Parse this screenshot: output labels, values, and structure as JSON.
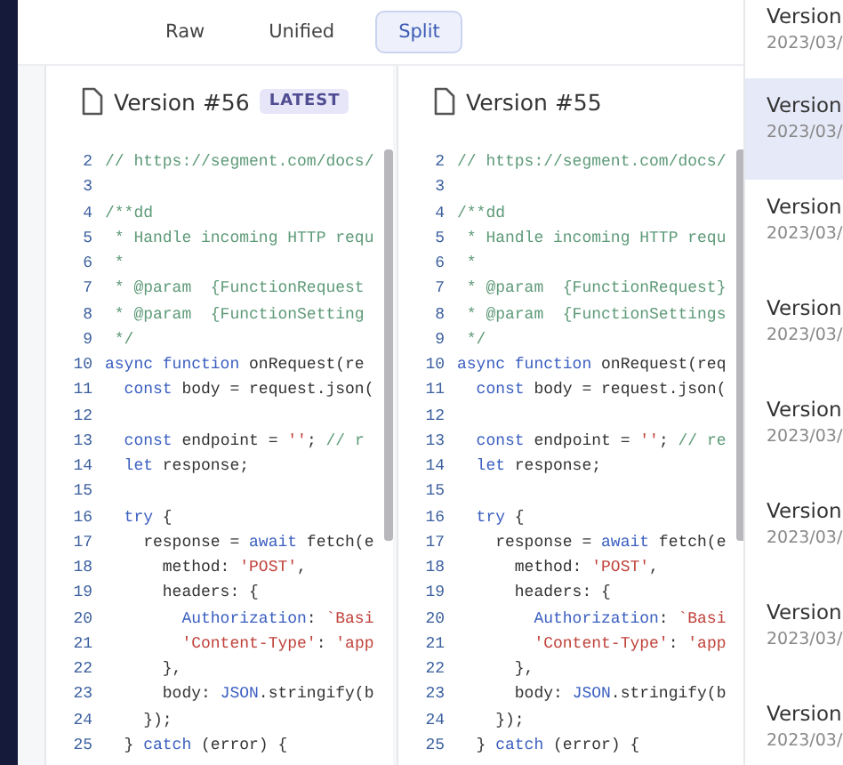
{
  "view_tabs": [
    {
      "label": "Raw",
      "selected": false
    },
    {
      "label": "Unified",
      "selected": false
    },
    {
      "label": "Split",
      "selected": true
    }
  ],
  "panels": [
    {
      "title": "Version #56",
      "badge": "LATEST",
      "lines": [
        {
          "number": "2",
          "tokens": [
            {
              "kind": "comment",
              "text": "// https://segment.com/docs/"
            }
          ]
        },
        {
          "number": "3"
        },
        {
          "number": "4",
          "tokens": [
            {
              "kind": "comment",
              "text": "/**dd"
            }
          ]
        },
        {
          "number": "5",
          "tokens": [
            {
              "kind": "comment",
              "text": " * Handle incoming HTTP requ"
            }
          ]
        },
        {
          "number": "6",
          "tokens": [
            {
              "kind": "comment",
              "text": " *"
            }
          ]
        },
        {
          "number": "7",
          "tokens": [
            {
              "kind": "comment",
              "text": " * @param  {FunctionRequest"
            }
          ]
        },
        {
          "number": "8",
          "tokens": [
            {
              "kind": "comment",
              "text": " * @param  {FunctionSetting"
            }
          ]
        },
        {
          "number": "9",
          "tokens": [
            {
              "kind": "comment",
              "text": " */"
            }
          ]
        },
        {
          "number": "10",
          "tokens": [
            {
              "kind": "keyword",
              "text": "async function "
            },
            {
              "kind": "plain",
              "text": "onRequest(re"
            }
          ]
        },
        {
          "number": "11",
          "tokens": [
            {
              "kind": "keyword",
              "text": "  const "
            },
            {
              "kind": "plain",
              "text": "body = request.json("
            }
          ]
        },
        {
          "number": "12"
        },
        {
          "number": "13",
          "tokens": [
            {
              "kind": "keyword",
              "text": "  const "
            },
            {
              "kind": "plain",
              "text": "endpoint = "
            },
            {
              "kind": "string",
              "text": "''"
            },
            {
              "kind": "plain",
              "text": "; "
            },
            {
              "kind": "comment",
              "text": "// r"
            }
          ]
        },
        {
          "number": "14",
          "tokens": [
            {
              "kind": "keyword",
              "text": "  let "
            },
            {
              "kind": "plain",
              "text": "response;"
            }
          ]
        },
        {
          "number": "15"
        },
        {
          "number": "16",
          "tokens": [
            {
              "kind": "keyword",
              "text": "  try "
            },
            {
              "kind": "plain",
              "text": "{"
            }
          ]
        },
        {
          "number": "17",
          "tokens": [
            {
              "kind": "plain",
              "text": "    response = "
            },
            {
              "kind": "keyword",
              "text": "await "
            },
            {
              "kind": "plain",
              "text": "fetch(e"
            }
          ]
        },
        {
          "number": "18",
          "tokens": [
            {
              "kind": "plain",
              "text": "      method: "
            },
            {
              "kind": "string",
              "text": "'POST'"
            },
            {
              "kind": "plain",
              "text": ","
            }
          ]
        },
        {
          "number": "19",
          "tokens": [
            {
              "kind": "plain",
              "text": "      headers: {"
            }
          ]
        },
        {
          "number": "20",
          "tokens": [
            {
              "kind": "keyword",
              "text": "        Authorization"
            },
            {
              "kind": "plain",
              "text": ": "
            },
            {
              "kind": "string",
              "text": "`Basi"
            }
          ]
        },
        {
          "number": "21",
          "tokens": [
            {
              "kind": "string",
              "text": "        'Content-Type'"
            },
            {
              "kind": "plain",
              "text": ": "
            },
            {
              "kind": "string",
              "text": "'app"
            }
          ]
        },
        {
          "number": "22",
          "tokens": [
            {
              "kind": "plain",
              "text": "      },"
            }
          ]
        },
        {
          "number": "23",
          "tokens": [
            {
              "kind": "plain",
              "text": "      body: "
            },
            {
              "kind": "keyword",
              "text": "JSON"
            },
            {
              "kind": "plain",
              "text": ".stringify(b"
            }
          ]
        },
        {
          "number": "24",
          "tokens": [
            {
              "kind": "plain",
              "text": "    });"
            }
          ]
        },
        {
          "number": "25",
          "tokens": [
            {
              "kind": "plain",
              "text": "  } "
            },
            {
              "kind": "keyword",
              "text": "catch "
            },
            {
              "kind": "plain",
              "text": "(error) {"
            }
          ]
        }
      ]
    },
    {
      "title": "Version #55",
      "lines": [
        {
          "number": "2",
          "tokens": [
            {
              "kind": "comment",
              "text": "// https://segment.com/docs/"
            }
          ]
        },
        {
          "number": "3"
        },
        {
          "number": "4",
          "tokens": [
            {
              "kind": "comment",
              "text": "/**dd"
            }
          ]
        },
        {
          "number": "5",
          "tokens": [
            {
              "kind": "comment",
              "text": " * Handle incoming HTTP requ"
            }
          ]
        },
        {
          "number": "6",
          "tokens": [
            {
              "kind": "comment",
              "text": " *"
            }
          ]
        },
        {
          "number": "7",
          "tokens": [
            {
              "kind": "comment",
              "text": " * @param  {FunctionRequest}"
            }
          ]
        },
        {
          "number": "8",
          "tokens": [
            {
              "kind": "comment",
              "text": " * @param  {FunctionSettings"
            }
          ]
        },
        {
          "number": "9",
          "tokens": [
            {
              "kind": "comment",
              "text": " */"
            }
          ]
        },
        {
          "number": "10",
          "tokens": [
            {
              "kind": "keyword",
              "text": "async function "
            },
            {
              "kind": "plain",
              "text": "onRequest(req"
            }
          ]
        },
        {
          "number": "11",
          "tokens": [
            {
              "kind": "keyword",
              "text": "  const "
            },
            {
              "kind": "plain",
              "text": "body = request.json("
            }
          ]
        },
        {
          "number": "12"
        },
        {
          "number": "13",
          "tokens": [
            {
              "kind": "keyword",
              "text": "  const "
            },
            {
              "kind": "plain",
              "text": "endpoint = "
            },
            {
              "kind": "string",
              "text": "''"
            },
            {
              "kind": "plain",
              "text": "; "
            },
            {
              "kind": "comment",
              "text": "// re"
            }
          ]
        },
        {
          "number": "14",
          "tokens": [
            {
              "kind": "keyword",
              "text": "  let "
            },
            {
              "kind": "plain",
              "text": "response;"
            }
          ]
        },
        {
          "number": "15"
        },
        {
          "number": "16",
          "tokens": [
            {
              "kind": "keyword",
              "text": "  try "
            },
            {
              "kind": "plain",
              "text": "{"
            }
          ]
        },
        {
          "number": "17",
          "tokens": [
            {
              "kind": "plain",
              "text": "    response = "
            },
            {
              "kind": "keyword",
              "text": "await "
            },
            {
              "kind": "plain",
              "text": "fetch(e"
            }
          ]
        },
        {
          "number": "18",
          "tokens": [
            {
              "kind": "plain",
              "text": "      method: "
            },
            {
              "kind": "string",
              "text": "'POST'"
            },
            {
              "kind": "plain",
              "text": ","
            }
          ]
        },
        {
          "number": "19",
          "tokens": [
            {
              "kind": "plain",
              "text": "      headers: {"
            }
          ]
        },
        {
          "number": "20",
          "tokens": [
            {
              "kind": "keyword",
              "text": "        Authorization"
            },
            {
              "kind": "plain",
              "text": ": "
            },
            {
              "kind": "string",
              "text": "`Basi"
            }
          ]
        },
        {
          "number": "21",
          "tokens": [
            {
              "kind": "string",
              "text": "        'Content-Type'"
            },
            {
              "kind": "plain",
              "text": ": "
            },
            {
              "kind": "string",
              "text": "'app"
            }
          ]
        },
        {
          "number": "22",
          "tokens": [
            {
              "kind": "plain",
              "text": "      },"
            }
          ]
        },
        {
          "number": "23",
          "tokens": [
            {
              "kind": "plain",
              "text": "      body: "
            },
            {
              "kind": "keyword",
              "text": "JSON"
            },
            {
              "kind": "plain",
              "text": ".stringify(b"
            }
          ]
        },
        {
          "number": "24",
          "tokens": [
            {
              "kind": "plain",
              "text": "    });"
            }
          ]
        },
        {
          "number": "25",
          "tokens": [
            {
              "kind": "plain",
              "text": "  } "
            },
            {
              "kind": "keyword",
              "text": "catch "
            },
            {
              "kind": "plain",
              "text": "(error) {"
            }
          ]
        }
      ]
    }
  ],
  "versions": [
    {
      "label": "Version",
      "date": "2023/03/",
      "selected": false
    },
    {
      "label": "Version",
      "date": "2023/03/",
      "selected": true
    },
    {
      "label": "Version",
      "date": "2023/03/",
      "selected": false
    },
    {
      "label": "Version",
      "date": "2023/03/",
      "selected": false
    },
    {
      "label": "Version",
      "date": "2023/03/",
      "selected": false
    },
    {
      "label": "Version",
      "date": "2023/03/",
      "selected": false
    },
    {
      "label": "Version",
      "date": "2023/03/",
      "selected": false
    },
    {
      "label": "Version",
      "date": "2023/03/",
      "selected": false
    }
  ]
}
